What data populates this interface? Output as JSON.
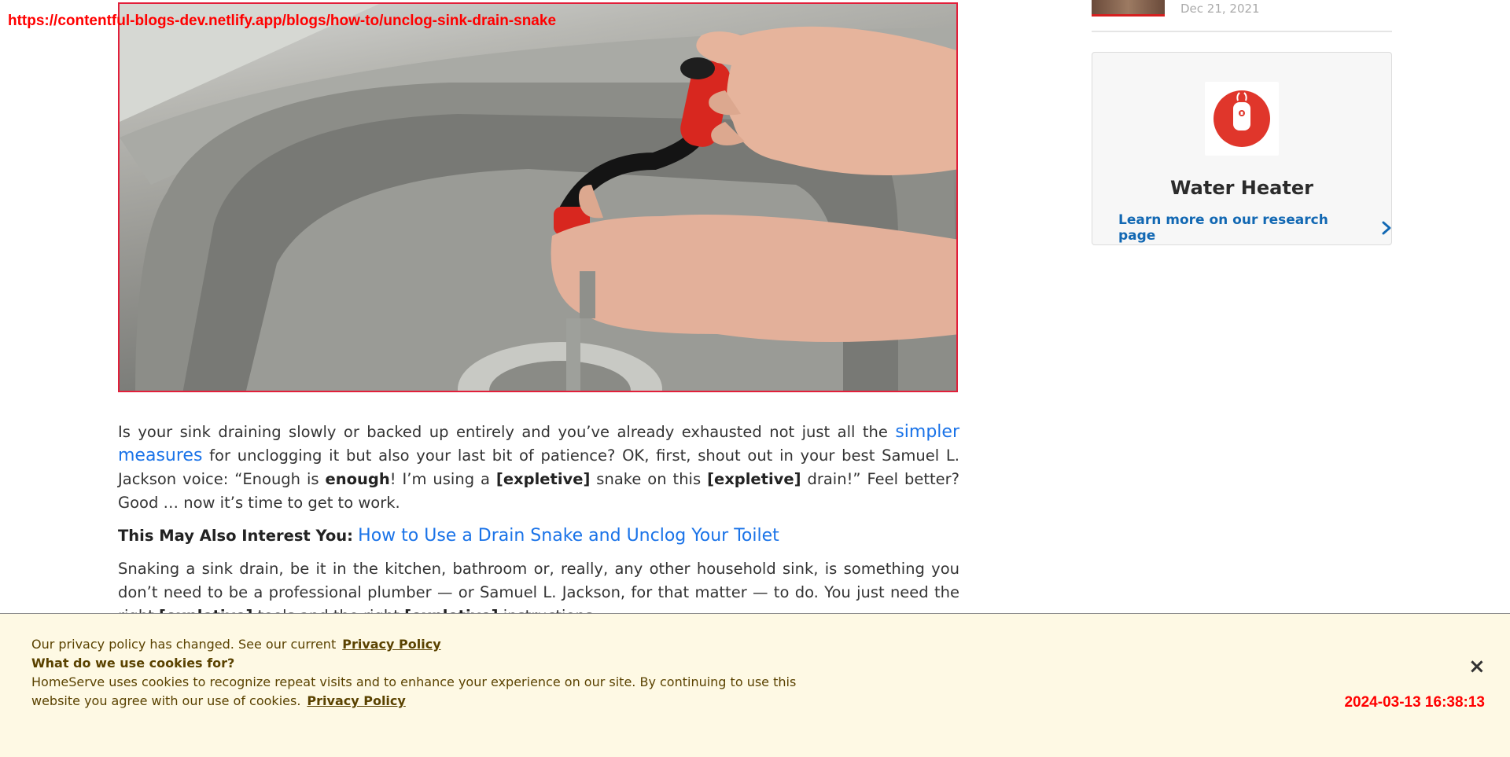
{
  "overlay": {
    "url": "https://contentful-blogs-dev.netlify.app/blogs/how-to/unclog-sink-drain-snake",
    "timestamp": "2024-03-13 16:38:13"
  },
  "hero": {
    "image_description": "hands-using-drain-snake-in-steel-sink-photo"
  },
  "article": {
    "p1_a": "Is your sink draining slowly or backed up entirely and you’ve already exhausted not just all the ",
    "p1_link": "simpler measures",
    "p1_b": " for unclogging it but also your last bit of patience? OK, first, shout out in your best Samuel L. Jackson voice: “Enough is ",
    "p1_bold1": "enough",
    "p1_c": "! I’m using a ",
    "p1_bold2": "[expletive]",
    "p1_d": " snake on this ",
    "p1_bold3": "[expletive]",
    "p1_e": " drain!” Feel better? Good … now it’s time to get to work.",
    "interest_label": "This May Also Interest You:",
    "interest_link": "How to Use a Drain Snake and Unclog Your Toilet",
    "p2_a": "Snaking a sink drain, be it in the kitchen, bathroom or, really, any other household sink, is something you don’t need to be a professional plumber — or Samuel L. Jackson, for that matter — to do. You just need the right ",
    "p2_bold1": "[expletive]",
    "p2_b": " tools and the right ",
    "p2_bold2": "[expletive]",
    "p2_c": " instructions."
  },
  "sidebar": {
    "recent_date": "Dec 21, 2021",
    "card": {
      "icon": "water-heater-icon",
      "title": "Water Heater",
      "link": "Learn more on our research page"
    }
  },
  "cookie": {
    "line1": "Our privacy policy has changed. See our current",
    "line1_link": "Privacy Policy",
    "line2": "What do we use cookies for?",
    "line3": "HomeServe uses cookies to recognize repeat visits and to enhance your experience on our site. By continuing to use this website you agree with our use of cookies.",
    "line3_link": "Privacy Policy",
    "close": "×"
  },
  "colors": {
    "accent_red": "#e21f3a",
    "link_blue": "#1a73e8",
    "sidebar_link_blue": "#1268b3",
    "cookie_bg": "#fef9e4",
    "cookie_text": "#5a4200"
  }
}
